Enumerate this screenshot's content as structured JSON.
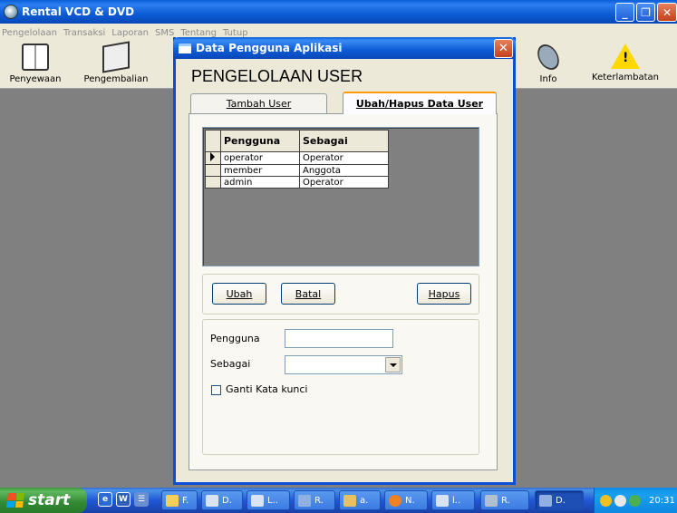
{
  "main_window": {
    "title": "Rental VCD & DVD",
    "minimize": "_",
    "maximize": "❐",
    "close": "✕"
  },
  "menu": [
    "Pengelolaan",
    "Transaksi",
    "Laporan",
    "SMS",
    "Tentang",
    "Tutup"
  ],
  "toolbar": {
    "penyewaan": "Penyewaan",
    "pengembalian": "Pengembalian",
    "info": "Info",
    "keterlambatan": "Keterlambatan"
  },
  "dialog": {
    "title": "Data Pengguna Aplikasi",
    "close": "✕",
    "heading": "PENGELOLAAN USER",
    "tabs": {
      "tambah": "Tambah User",
      "ubah": "Ubah/Hapus Data User"
    },
    "grid": {
      "headers": [
        "Pengguna",
        "Sebagai"
      ],
      "rows": [
        [
          "operator",
          "Operator"
        ],
        [
          "member",
          "Anggota"
        ],
        [
          "admin",
          "Operator"
        ]
      ]
    },
    "buttons": {
      "ubah": "Ubah",
      "batal": "Batal",
      "hapus": "Hapus"
    },
    "form": {
      "pengguna_label": "Pengguna",
      "pengguna_value": "",
      "sebagai_label": "Sebagai",
      "sebagai_value": "",
      "ganti_label": "Ganti Kata kunci"
    }
  },
  "taskbar": {
    "start": "start",
    "buttons": [
      "F.",
      "D.",
      "L..",
      "R.",
      "a.",
      "N.",
      "l..",
      "R.",
      "D."
    ],
    "clock": "20:31"
  }
}
